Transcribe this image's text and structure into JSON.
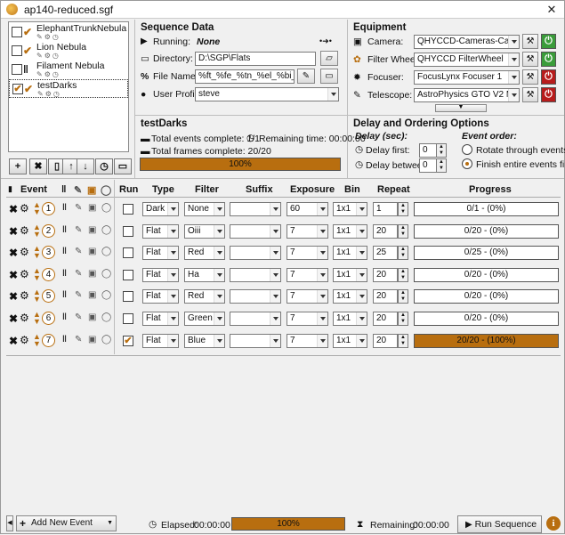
{
  "window": {
    "title": "ap140-reduced.sgf"
  },
  "targets": [
    {
      "name": "ElephantTrunkNebula",
      "checked": false
    },
    {
      "name": "Lion Nebula",
      "checked": false
    },
    {
      "name": "Filament Nebula",
      "checked": false,
      "paused": true
    },
    {
      "name": "testDarks",
      "checked": true,
      "selected": true
    }
  ],
  "sequence_data": {
    "title": "Sequence Data",
    "running_label": "Running:",
    "running_value": "None",
    "directory_label": "Directory:",
    "directory_value": "D:\\SGP\\Flats",
    "filename_label": "File Name:",
    "filename_value": "%ft_%fe_%tn_%el_%bi_%su_",
    "profile_label": "User Profile:",
    "profile_value": "steve"
  },
  "equipment": {
    "title": "Equipment",
    "camera_label": "Camera:",
    "camera_value": "QHYCCD-Cameras-Capture",
    "filterwheel_label": "Filter Wheel:",
    "filterwheel_value": "QHYCCD FilterWheel",
    "focuser_label": "Focuser:",
    "focuser_value": "FocusLynx Focuser 1",
    "telescope_label": "Telescope:",
    "telescope_value": "AstroPhysics GTO V2 Mount"
  },
  "target_status": {
    "title": "testDarks",
    "events_label": "Total events complete: 1/1",
    "remaining_label": "Remaining time: 00:00:00",
    "frames_label": "Total frames complete: 20/20",
    "progress_text": "100%",
    "progress": 1.0
  },
  "delay": {
    "title": "Delay and Ordering Options",
    "delay_sec_label": "Delay (sec):",
    "delay_first_label": "Delay first:",
    "delay_first_value": "0",
    "delay_between_label": "Delay between:",
    "delay_between_value": "0",
    "event_order_label": "Event order:",
    "rotate_label": "Rotate through events",
    "finish_label": "Finish entire events first"
  },
  "columns": {
    "event": "Event",
    "run": "Run",
    "type": "Type",
    "filter": "Filter",
    "suffix": "Suffix",
    "exposure": "Exposure",
    "bin": "Bin",
    "repeat": "Repeat",
    "progress": "Progress"
  },
  "events": [
    {
      "num": "1",
      "run": false,
      "type": "Dark",
      "filter": "None",
      "suffix": "",
      "exposure": "60",
      "bin": "1x1",
      "repeat": "1",
      "progress_text": "0/1 - (0%)",
      "progress": 0
    },
    {
      "num": "2",
      "run": false,
      "type": "Flat",
      "filter": "Oiii",
      "suffix": "",
      "exposure": "7",
      "bin": "1x1",
      "repeat": "20",
      "progress_text": "0/20 - (0%)",
      "progress": 0
    },
    {
      "num": "3",
      "run": false,
      "type": "Flat",
      "filter": "Red",
      "suffix": "",
      "exposure": "7",
      "bin": "1x1",
      "repeat": "25",
      "progress_text": "0/25 - (0%)",
      "progress": 0
    },
    {
      "num": "4",
      "run": false,
      "type": "Flat",
      "filter": "Ha",
      "suffix": "",
      "exposure": "7",
      "bin": "1x1",
      "repeat": "20",
      "progress_text": "0/20 - (0%)",
      "progress": 0
    },
    {
      "num": "5",
      "run": false,
      "type": "Flat",
      "filter": "Red",
      "suffix": "",
      "exposure": "7",
      "bin": "1x1",
      "repeat": "20",
      "progress_text": "0/20 - (0%)",
      "progress": 0
    },
    {
      "num": "6",
      "run": false,
      "type": "Flat",
      "filter": "Green",
      "suffix": "",
      "exposure": "7",
      "bin": "1x1",
      "repeat": "20",
      "progress_text": "0/20 - (0%)",
      "progress": 0
    },
    {
      "num": "7",
      "run": true,
      "type": "Flat",
      "filter": "Blue",
      "suffix": "",
      "exposure": "7",
      "bin": "1x1",
      "repeat": "20",
      "progress_text": "20/20 - (100%)",
      "progress": 1.0
    }
  ],
  "bottom": {
    "add_event_label": "Add New Event",
    "elapsed_label": "Elapsed:",
    "elapsed_value": "00:00:00",
    "progress_text": "100%",
    "progress": 1.0,
    "remaining_label": "Remaining:",
    "remaining_value": "00:00:00",
    "run_sequence_label": "Run Sequence"
  },
  "colors": {
    "accent": "#b86e0f",
    "power_on": "#3a9c3a",
    "power_off": "#b71c1c"
  }
}
